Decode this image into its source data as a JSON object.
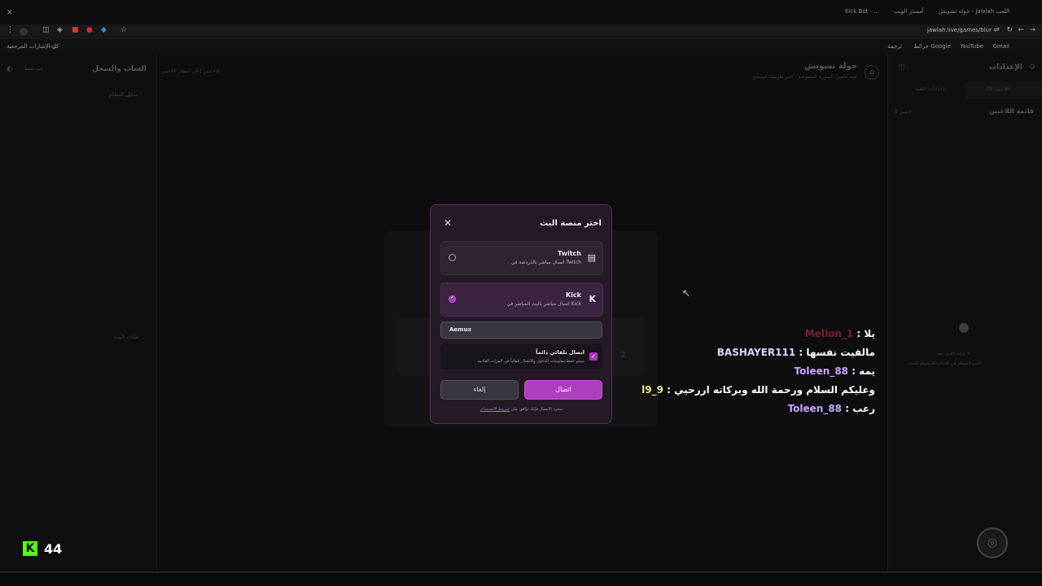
{
  "browser": {
    "tabs": [
      "جولة تشويش - Jawlah اللعب",
      "أمستر الويب",
      "Kick Bot - ..."
    ],
    "url": "jawlah.live/games/blur",
    "bookmarks": [
      "Gmail",
      "YouTube",
      "خرائط Google",
      "ترجمة"
    ],
    "all_bookmarks": "كل الإشارات المرجعية"
  },
  "left_panel": {
    "title": "الشات والسجل",
    "filter": "غير نشط",
    "log_label": "سجل النظام",
    "chat_label": "شات البث"
  },
  "header": {
    "game_title": "جولة تشويش",
    "game_subtitle": "لعبة تخمين الصورة المشوشة - اختر طريقك الصحيح",
    "status": "٥ لاعبين | في انتظار اللاعبين",
    "card_number": "1"
  },
  "right_panel": {
    "title": "الإعدادات",
    "tabs": [
      "اللاعبين (0)",
      "إعدادات اللعبة"
    ],
    "players_title": "قائمة اللاعبين",
    "players_count": "0 لاعبين",
    "empty_1": "لا يوجد لاعبين بعد",
    "empty_2": "اكتب انضمام في الشات للانضمام للعبة"
  },
  "modal": {
    "title": "اختر منصة البث",
    "close_icon": "close-icon",
    "options": [
      {
        "name": "Twitch",
        "desc": "اتصال مباشر بالدردشة في Twitch",
        "icon": "twitch-icon",
        "selected": false
      },
      {
        "name": "Kick",
        "desc": "اتصال مباشر بالبث المباشر في Kick",
        "icon": "kick-icon",
        "selected": true
      }
    ],
    "username_value": "Aemux",
    "auto_connect_title": "اتصال تلقائي دائماً",
    "auto_connect_desc": "سيتم حفظ معلومات الدخول والاتصال تلقائياً في المرات القادمة",
    "auto_connect_checked": true,
    "cancel_label": "إلغاء",
    "connect_label": "اتصال",
    "footer_text": "بمجرد الاتصال فإنك توافق على",
    "footer_link": "شروط الاستخدام",
    "accent": "#b03fc0"
  },
  "chat_overlay": [
    {
      "user": "Mellon_1",
      "message": "يلا",
      "color": "#7a1f2a"
    },
    {
      "user": "BASHAYER111",
      "message": "مالقيت نفسها",
      "color": "#ffffff"
    },
    {
      "user": "Toleen_88",
      "message": "يمه",
      "color": "#c9a6ff"
    },
    {
      "user": "l9_9",
      "message": "وعليكم السلام ورحمة الله وبركاته اررحيي",
      "color": "#f0e68c"
    },
    {
      "user": "Toleen_88",
      "message": "رعب",
      "color": "#c9a6ff"
    }
  ],
  "kick_counter": {
    "logo": "K",
    "count": "44",
    "color": "#53fc18"
  }
}
